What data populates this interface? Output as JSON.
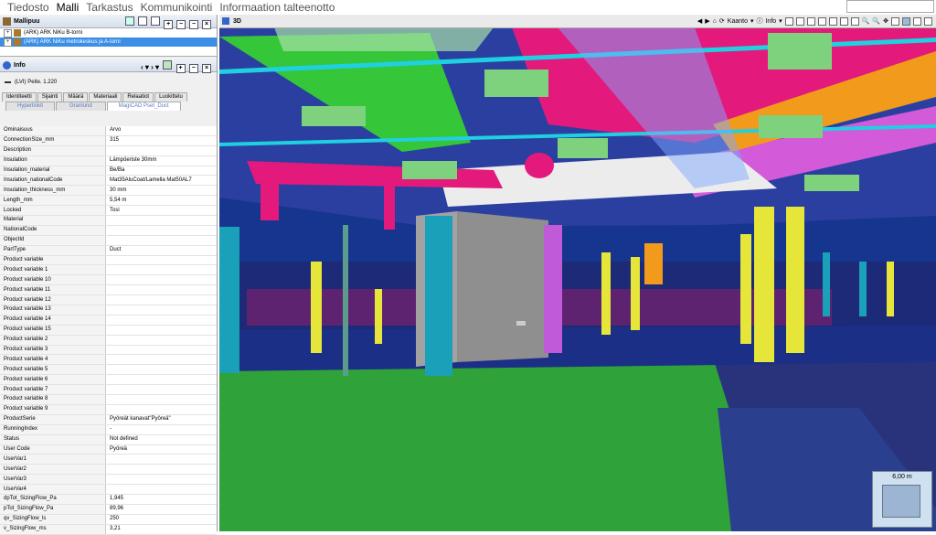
{
  "menu": [
    "Tiedosto",
    "Malli",
    "Tarkastus",
    "Kommunikointi",
    "Informaation talteenotto"
  ],
  "menu_active": "Malli",
  "model_tree": {
    "title": "Mallipuu",
    "items": [
      {
        "label": "(ARK) ARK NiKu  B-torni",
        "selected": false
      },
      {
        "label": "(ARK) ARK NiKu metrokeskus ja A-torni",
        "selected": true
      }
    ]
  },
  "info": {
    "title": "Info",
    "object": "(LVI) Peite. 1.220",
    "tabs": [
      "Identiteetti",
      "Sijainti",
      "Määrä",
      "Materiaali",
      "Relaatiot",
      "Luokittelu"
    ],
    "subtabs": [
      "Hyperlinkit",
      "Granlund",
      "MagiCAD Pset_Duct"
    ],
    "header": {
      "key": "Ominaisuus",
      "value": "Arvo"
    },
    "rows": [
      [
        "ConnectionSize_mm",
        "315"
      ],
      [
        "Description",
        ""
      ],
      [
        "Insulation",
        "Lämpöeriste 30mm"
      ],
      [
        "Insulation_material",
        "Be/Ba"
      ],
      [
        "Insulation_nationalCode",
        "Mat35AluCoat/Lamella Mat50AL7"
      ],
      [
        "Insulation_thickness_mm",
        "30 mm"
      ],
      [
        "Length_mm",
        "5,54 m"
      ],
      [
        "Locked",
        "Tosi"
      ],
      [
        "Material",
        ""
      ],
      [
        "NationalCode",
        ""
      ],
      [
        "ObjectId",
        ""
      ],
      [
        "PartType",
        "Duct"
      ],
      [
        "Product variable",
        ""
      ],
      [
        "Product variable 1",
        ""
      ],
      [
        "Product variable 10",
        ""
      ],
      [
        "Product variable 11",
        ""
      ],
      [
        "Product variable 12",
        ""
      ],
      [
        "Product variable 13",
        ""
      ],
      [
        "Product variable 14",
        ""
      ],
      [
        "Product variable 15",
        ""
      ],
      [
        "Product variable 2",
        ""
      ],
      [
        "Product variable 3",
        ""
      ],
      [
        "Product variable 4",
        ""
      ],
      [
        "Product variable 5",
        ""
      ],
      [
        "Product variable 6",
        ""
      ],
      [
        "Product variable 7",
        ""
      ],
      [
        "Product variable 8",
        ""
      ],
      [
        "Product variable 9",
        ""
      ],
      [
        "ProductSerie",
        "Pyöreät kanavat\"Pyöreä\""
      ],
      [
        "RunningIndex",
        "-"
      ],
      [
        "Status",
        "Not defined"
      ],
      [
        "User Code",
        "Pyöreä"
      ],
      [
        "UserVar1",
        ""
      ],
      [
        "UserVar2",
        ""
      ],
      [
        "UserVar3",
        ""
      ],
      [
        "UserVar4",
        ""
      ],
      [
        "dpTot_SizingFlow_Pa",
        "1,945"
      ],
      [
        "pTot_SizingFlow_Pa",
        "89,96"
      ],
      [
        "qv_SizingFlow_ls",
        "250"
      ],
      [
        "v_SizingFlow_ms",
        "3,21"
      ]
    ]
  },
  "viewport": {
    "title": "3D",
    "toolbar": {
      "kaanto": "Kaanto",
      "info": "Info"
    },
    "scale": "6,00 m"
  },
  "colors": {
    "selection": "#3a8ee6",
    "floor": "#2fa33a",
    "ducts_magenta": "#e4197c",
    "trays": "#8ad18a"
  }
}
